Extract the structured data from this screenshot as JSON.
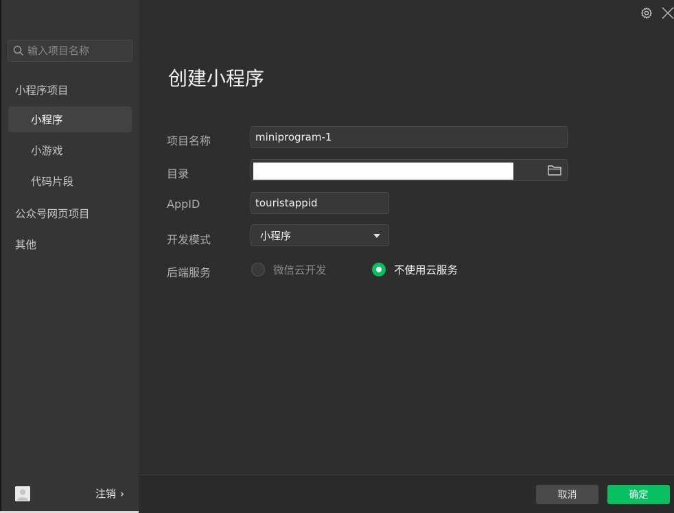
{
  "sidebar": {
    "search_placeholder": "输入项目名称",
    "sections": [
      {
        "label": "小程序项目"
      },
      {
        "label": "公众号网页项目"
      },
      {
        "label": "其他"
      }
    ],
    "sub_items": [
      {
        "label": "小程序",
        "active": true
      },
      {
        "label": "小游戏",
        "active": false
      },
      {
        "label": "代码片段",
        "active": false
      }
    ],
    "footer": {
      "logout_label": "注销",
      "logout_chevron": "›"
    }
  },
  "main": {
    "title": "创建小程序",
    "form": {
      "project_name_label": "项目名称",
      "project_name_value": "miniprogram-1",
      "directory_label": "目录",
      "directory_value": "",
      "appid_label": "AppID",
      "appid_value": "touristappid",
      "dev_mode_label": "开发模式",
      "dev_mode_value": "小程序",
      "backend_label": "后端服务",
      "backend_options": [
        {
          "label": "微信云开发",
          "checked": false,
          "disabled": true
        },
        {
          "label": "不使用云服务",
          "checked": true,
          "disabled": false
        }
      ]
    }
  },
  "footer": {
    "cancel_label": "取消",
    "confirm_label": "确定"
  },
  "colors": {
    "accent": "#07c160",
    "sidebar_bg": "#353535",
    "main_bg": "#2e2e2e"
  },
  "icons": [
    "search-icon",
    "gear-icon",
    "close-icon",
    "folder-icon",
    "avatar-icon",
    "chevron-down-icon"
  ]
}
